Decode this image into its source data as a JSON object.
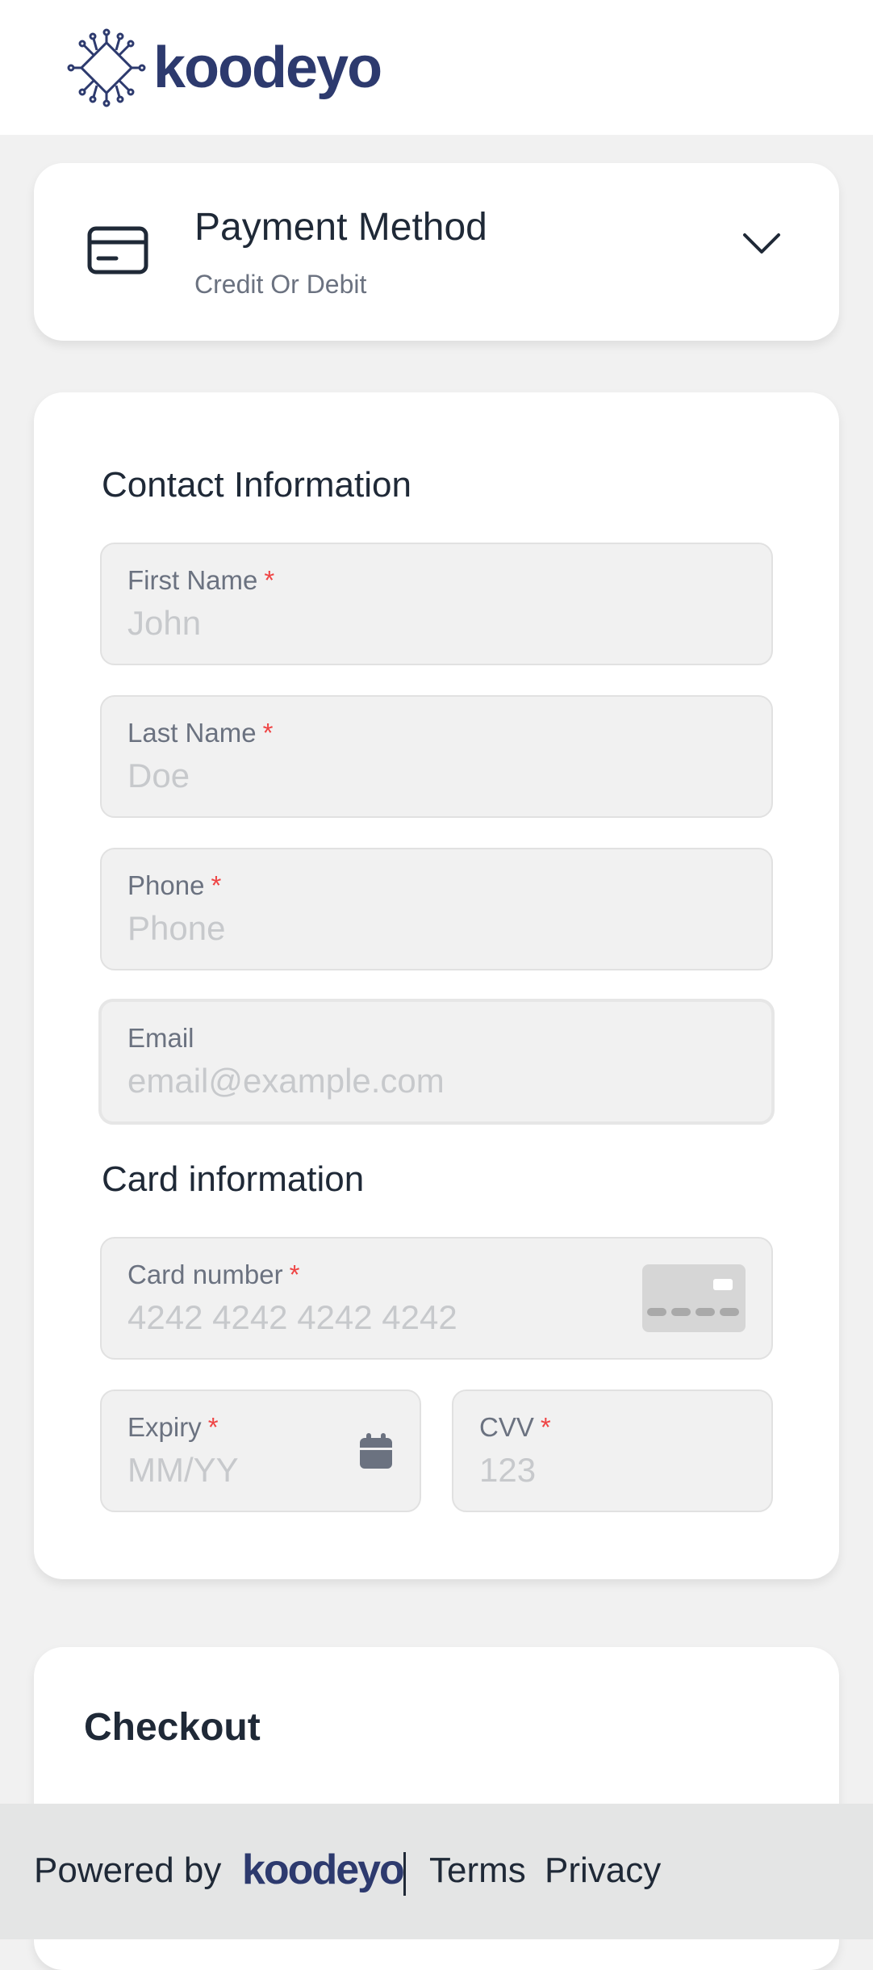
{
  "header": {
    "logo_text": "koodeyo"
  },
  "payment_method": {
    "title": "Payment Method",
    "subtitle": "Credit Or Debit",
    "icon": "credit-card-icon",
    "toggle_icon": "chevron-down-icon"
  },
  "contact": {
    "section_title": "Contact Information",
    "first_name": {
      "label": "First Name",
      "placeholder": "John",
      "required": "*"
    },
    "last_name": {
      "label": "Last Name",
      "placeholder": "Doe",
      "required": "*"
    },
    "phone": {
      "label": "Phone",
      "placeholder": "Phone",
      "required": "*"
    },
    "email": {
      "label": "Email",
      "placeholder": "email@example.com"
    }
  },
  "card": {
    "section_title": "Card information",
    "number": {
      "label": "Card number",
      "placeholder": "4242 4242 4242 4242",
      "required": "*"
    },
    "expiry": {
      "label": "Expiry",
      "placeholder": "MM/YY",
      "required": "*"
    },
    "cvv": {
      "label": "CVV",
      "placeholder": "123",
      "required": "*"
    }
  },
  "checkout": {
    "title": "Checkout"
  },
  "footer": {
    "powered_by": "Powered by",
    "logo_text": "koodeyo",
    "terms": "Terms",
    "privacy": "Privacy"
  },
  "colors": {
    "brand": "#2d3a6e",
    "required": "#ef4444",
    "page_bg": "#f1f1f1"
  }
}
